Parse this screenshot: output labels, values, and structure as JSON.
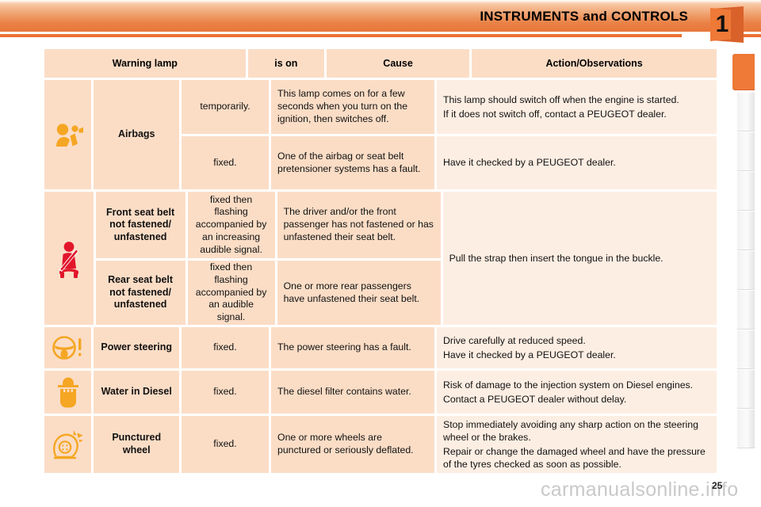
{
  "header": {
    "title": "INSTRUMENTS and CONTROLS",
    "chapter_number": "1",
    "accent_color": "#ef7937",
    "banner_gradient_top": "#f7c9a6",
    "banner_gradient_bottom": "#e8763a"
  },
  "table": {
    "columns": [
      {
        "key": "warning_lamp",
        "label": "Warning lamp"
      },
      {
        "key": "is_on",
        "label": "is on"
      },
      {
        "key": "cause",
        "label": "Cause"
      },
      {
        "key": "action",
        "label": "Action/Observations"
      }
    ],
    "header_bg": "#fbddc6",
    "cell_bg": "#fbddc6",
    "action_bg": "#fdeee3",
    "rows": [
      {
        "id": "airbags",
        "icon": "airbag-icon",
        "icon_color": "#f5a623",
        "name": "Airbags",
        "subrows": [
          {
            "is_on": "temporarily.",
            "cause": "This lamp comes on for a few seconds when you turn on the ignition, then switches off.",
            "action": [
              "This lamp should switch off when the engine is started.",
              "If it does not switch off, contact a PEUGEOT dealer."
            ]
          },
          {
            "is_on": "fixed.",
            "cause": "One of the airbag or seat belt pretensioner systems has a fault.",
            "action": [
              "Have it checked by a PEUGEOT dealer."
            ]
          }
        ]
      },
      {
        "id": "seat-belts",
        "icon": "seatbelt-icon",
        "icon_color": "#e2152b",
        "merged_action": "Pull the strap then insert the tongue in the buckle.",
        "subrows": [
          {
            "name": "Front seat belt not fastened/ unfastened",
            "is_on": "fixed then flashing accompanied by an increasing audible signal.",
            "cause": "The driver and/or the front passenger has not fastened or has unfastened their seat belt."
          },
          {
            "name": "Rear seat belt not fastened/ unfastened",
            "is_on": "fixed then flashing accompanied by an audible signal.",
            "cause": "One or more rear passengers have unfastened their seat belt."
          }
        ]
      },
      {
        "id": "power-steering",
        "icon": "steering-wheel-warning-icon",
        "icon_color": "#f5a623",
        "name": "Power steering",
        "subrows": [
          {
            "is_on": "fixed.",
            "cause": "The power steering has a fault.",
            "cause_justify": true,
            "action": [
              "Drive carefully at reduced speed.",
              "Have it checked by a PEUGEOT dealer."
            ]
          }
        ]
      },
      {
        "id": "water-in-diesel",
        "icon": "water-in-diesel-icon",
        "icon_color": "#f5a623",
        "name": "Water in Diesel",
        "subrows": [
          {
            "is_on": "fixed.",
            "cause": "The diesel filter contains water.",
            "action": [
              "Risk of damage to the injection system on Diesel engines.",
              "Contact a PEUGEOT dealer without delay."
            ]
          }
        ]
      },
      {
        "id": "punctured-wheel",
        "icon": "punctured-wheel-icon",
        "icon_color": "#f5a623",
        "name": "Punctured wheel",
        "subrows": [
          {
            "is_on": "fixed.",
            "cause": "One or more wheels are punctured or seriously deflated.",
            "action": [
              "Stop immediately avoiding any sharp action on the steering wheel or the brakes.",
              "Repair or change the damaged wheel and have the pressure of the tyres checked as soon as possible."
            ]
          }
        ]
      }
    ]
  },
  "footer": {
    "watermark": "carmanualsonline.info",
    "page_number": "25"
  }
}
